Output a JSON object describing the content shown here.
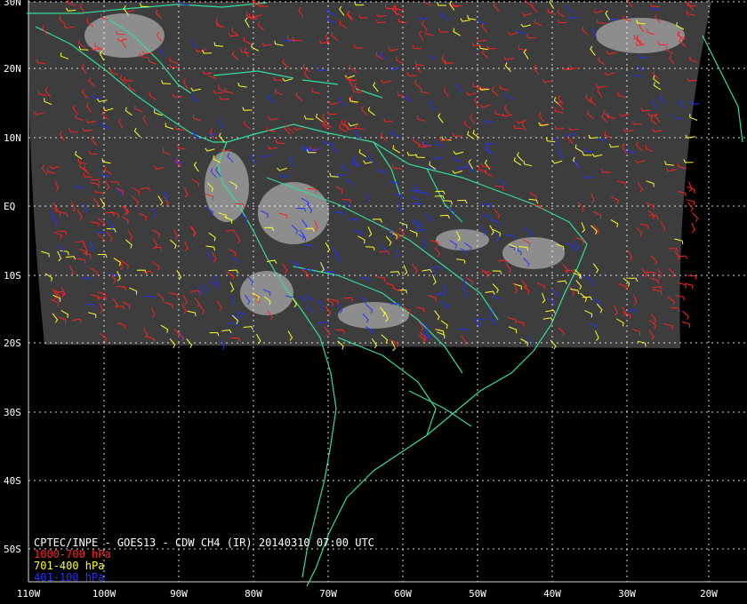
{
  "title": "CPTEC/INPE - GOES13 - CDW CH4 (IR) 20140310 07:00 UTC",
  "legend": [
    {
      "label": "1000-700 hPa",
      "color": "#ff2222"
    },
    {
      "label": "701-400 hPa",
      "color": "#ffff22"
    },
    {
      "label": "401-100 hPa",
      "color": "#2233ff"
    }
  ],
  "lat_labels": [
    "30N",
    "20N",
    "10N",
    "EQ",
    "10S",
    "20S",
    "30S",
    "40S",
    "50S"
  ],
  "lon_labels": [
    "110W",
    "100W",
    "90W",
    "80W",
    "70W",
    "60W",
    "50W",
    "40W",
    "30W",
    "20W"
  ],
  "colors": {
    "background": "#000000",
    "coastline": "#33dd99",
    "grid": "#ffffff",
    "satellite": "#3a3a3a"
  }
}
